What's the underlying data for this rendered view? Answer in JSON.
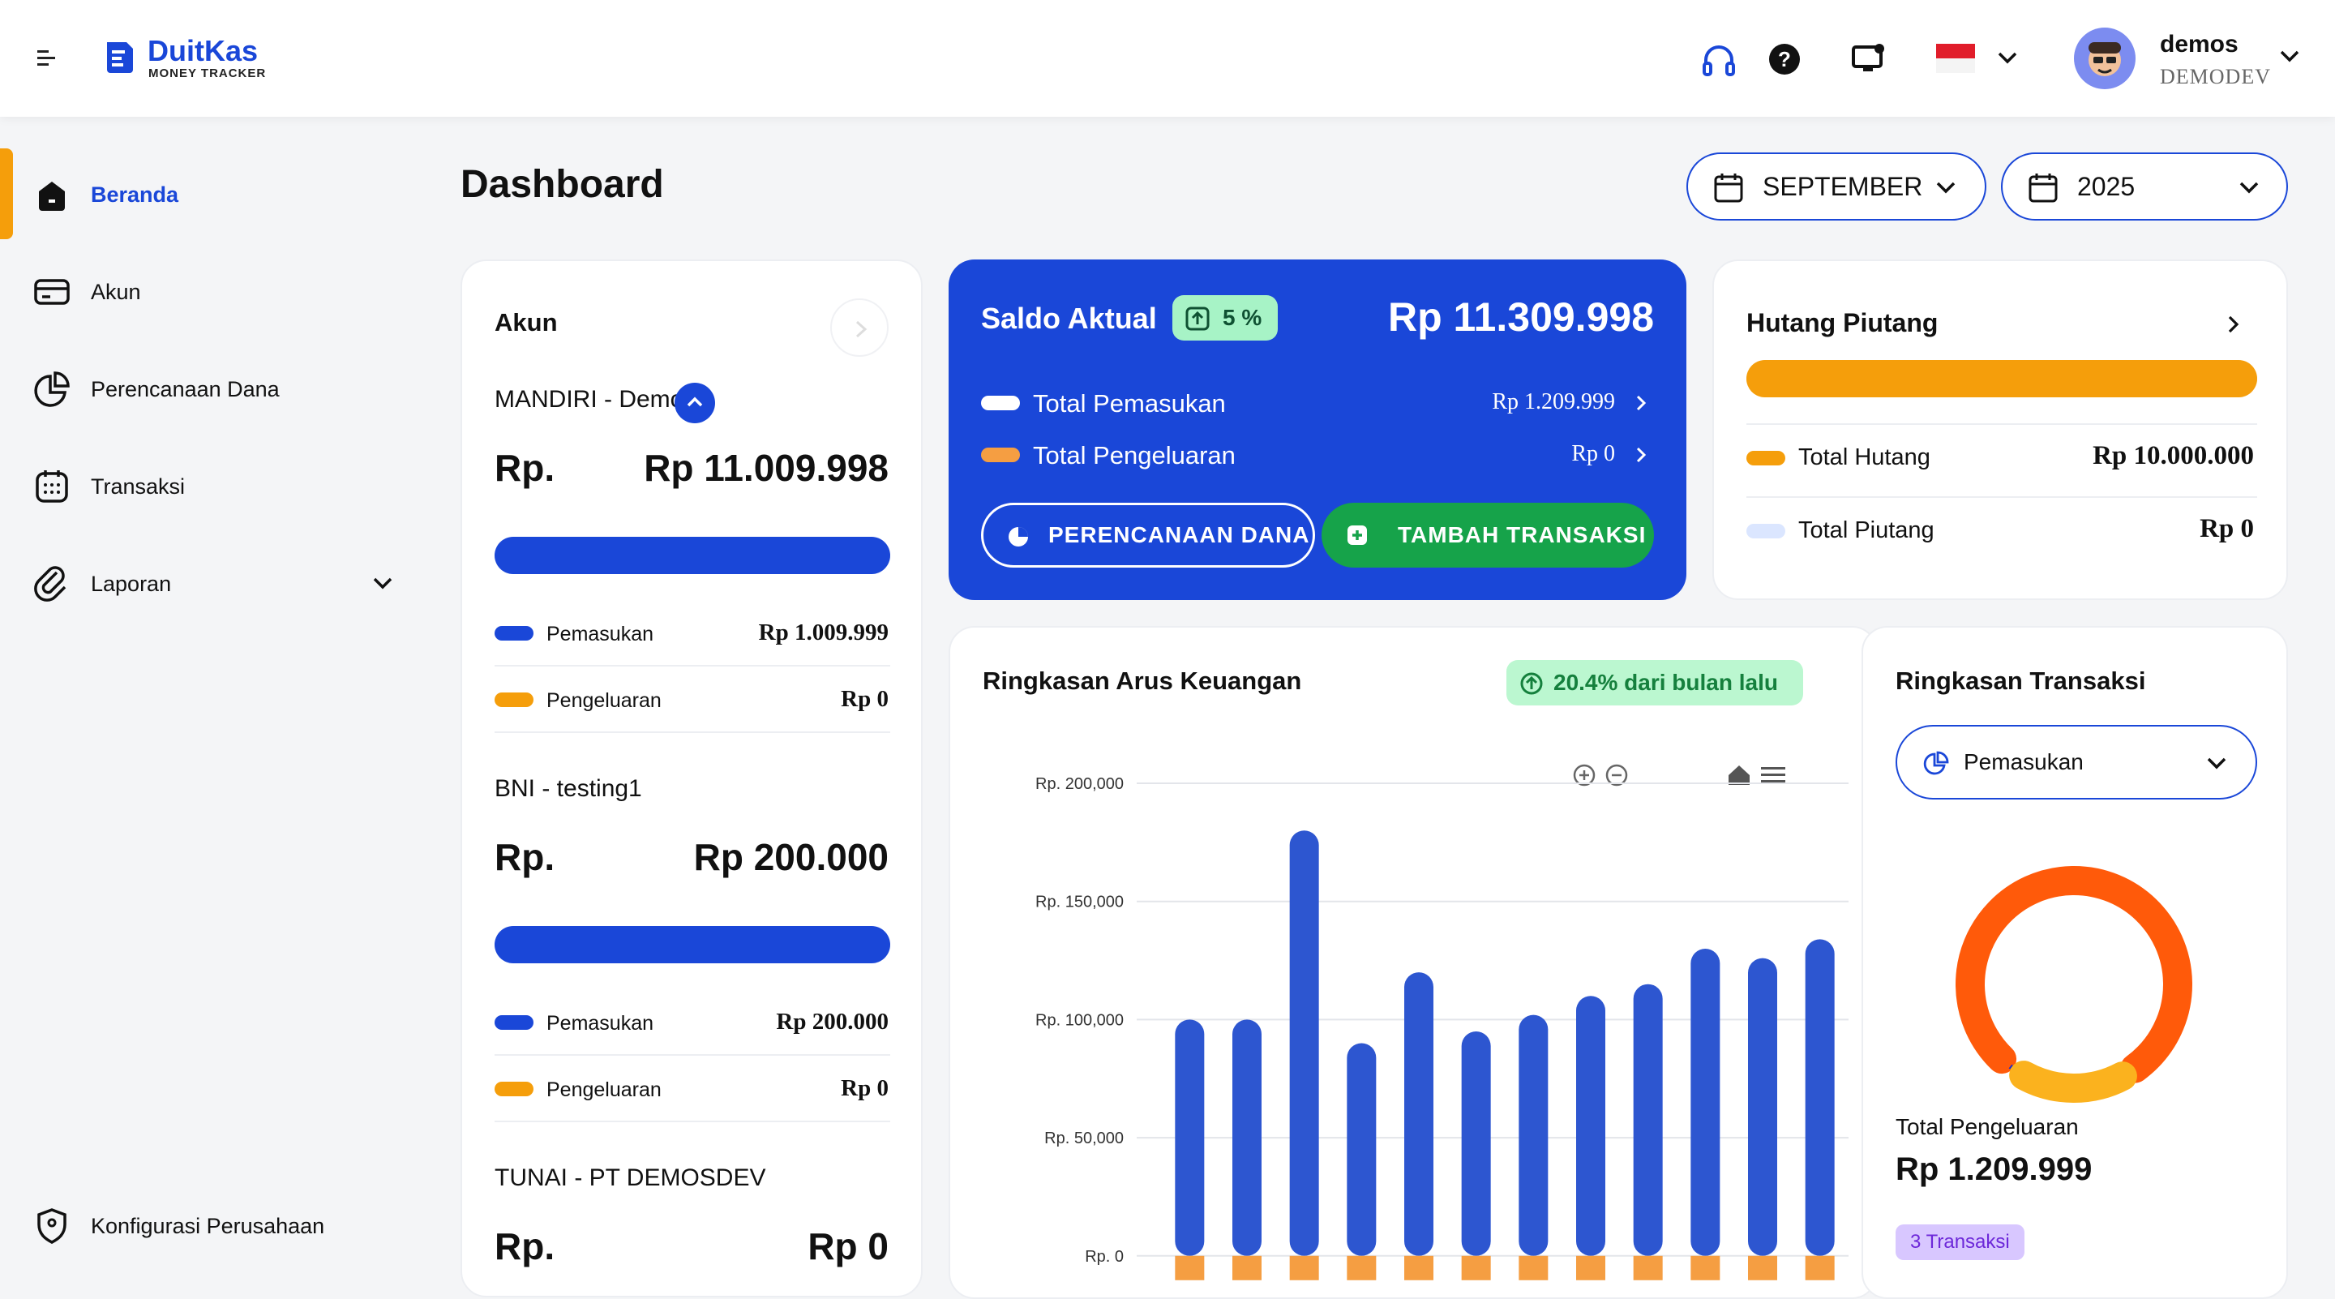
{
  "app": {
    "name": "DuitKas",
    "tagline": "MONEY TRACKER",
    "language_flag": "Indonesia"
  },
  "user": {
    "name": "demos",
    "company": "DEMODEV"
  },
  "sidebar": {
    "items": [
      {
        "label": "Beranda",
        "icon": "home-icon",
        "active": true
      },
      {
        "label": "Akun",
        "icon": "card-icon"
      },
      {
        "label": "Perencanaan Dana",
        "icon": "pie-icon"
      },
      {
        "label": "Transaksi",
        "icon": "calendar-icon"
      },
      {
        "label": "Laporan",
        "icon": "clip-icon"
      }
    ],
    "bottom_item": {
      "label": "Konfigurasi Perusahaan",
      "icon": "shield-icon"
    }
  },
  "page": {
    "title": "Dashboard"
  },
  "filters": {
    "month": "SEPTEMBER",
    "year": "2025"
  },
  "akun": {
    "title": "Akun",
    "accounts": [
      {
        "name": "MANDIRI - Demo A",
        "currency": "Rp.",
        "balance": "Rp 11.009.998",
        "income_label": "Pemasukan",
        "income": "Rp 1.009.999",
        "expense_label": "Pengeluaran",
        "expense": "Rp 0"
      },
      {
        "name": "BNI - testing1",
        "currency": "Rp.",
        "balance": "Rp 200.000",
        "income_label": "Pemasukan",
        "income": "Rp 200.000",
        "expense_label": "Pengeluaran",
        "expense": "Rp 0"
      },
      {
        "name": "TUNAI - PT DEMOSDEV",
        "currency": "Rp.",
        "balance": "Rp 0"
      }
    ]
  },
  "saldo": {
    "title": "Saldo Aktual",
    "badge": "5 %",
    "amount": "Rp 11.309.998",
    "rows": [
      {
        "label": "Total Pemasukan",
        "value": "Rp 1.209.999"
      },
      {
        "label": "Total Pengeluaran",
        "value": "Rp 0"
      }
    ],
    "btn_plan": "PERENCANAAN DANA",
    "btn_add": "TAMBAH TRANSAKSI"
  },
  "hutang": {
    "title": "Hutang Piutang",
    "hutang_fraction": 1.0,
    "rows": [
      {
        "label": "Total Hutang",
        "value": "Rp 10.000.000"
      },
      {
        "label": "Total Piutang",
        "value": "Rp 0"
      }
    ]
  },
  "arus": {
    "title": "Ringkasan Arus Keuangan",
    "badge": "20.4% dari bulan lalu"
  },
  "chart_data": {
    "type": "bar",
    "title": "Ringkasan Arus Keuangan",
    "ylim": [
      0,
      200000
    ],
    "yticks": [
      "Rp. 0",
      "Rp. 50,000",
      "Rp. 100,000",
      "Rp. 150,000",
      "Rp. 200,000"
    ],
    "ytick_values": [
      0,
      50000,
      100000,
      150000,
      200000
    ],
    "grid": true,
    "series": [
      {
        "values": [
          100000,
          100000,
          180000,
          90000,
          120000,
          95000,
          102000,
          110000,
          115000,
          130000,
          126000,
          134000
        ],
        "color": "#2d56d0"
      },
      {
        "values": [
          0,
          0,
          0,
          0,
          0,
          0,
          0,
          0,
          0,
          0,
          0,
          0
        ],
        "color": "#f59e42"
      }
    ]
  },
  "transaksi": {
    "title": "Ringkasan Transaksi",
    "select_value": "Pemasukan",
    "total_label": "Total Pengeluaran",
    "total_value": "Rp 1.209.999",
    "count_badge": "3 Transaksi",
    "donut": [
      {
        "fraction": 0.8,
        "color": "#ff5a0a"
      },
      {
        "fraction": 0.18,
        "color": "#fbb21e"
      },
      {
        "fraction": 0.02,
        "color": "#1a2fd0"
      }
    ]
  },
  "colors": {
    "primary": "#1a47d8",
    "accent": "#f59e0b",
    "green": "#16a34a"
  }
}
